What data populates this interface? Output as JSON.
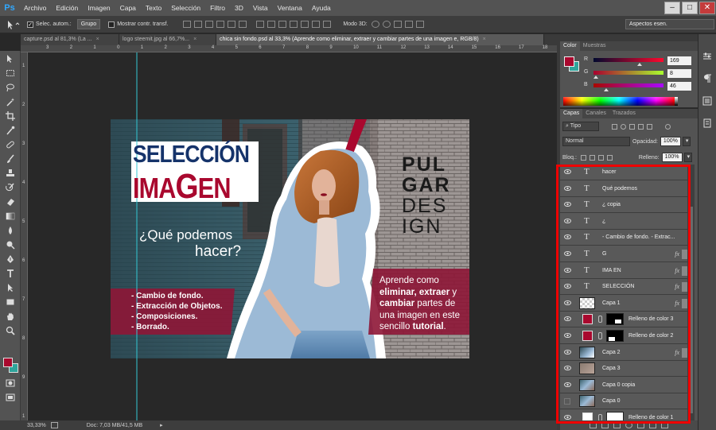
{
  "app": {
    "logo": "Ps"
  },
  "menu": [
    "Archivo",
    "Edición",
    "Imagen",
    "Capa",
    "Texto",
    "Selección",
    "Filtro",
    "3D",
    "Vista",
    "Ventana",
    "Ayuda"
  ],
  "window_controls": [
    "–",
    "□",
    "✕"
  ],
  "options": {
    "auto_select_label": "Selec. autom.:",
    "auto_select_value": "Grupo",
    "transform_label": "Mostrar contr. transf.",
    "mode3d_label": "Modo 3D:",
    "workspace": "Aspectos esen."
  },
  "tabs": [
    {
      "label": "capture.psd al 81,3% (La ...",
      "active": false
    },
    {
      "label": "logo steemit.jpg al 66,7%...",
      "active": false
    },
    {
      "label": "chica sin fondo.psd al 33,3% (Aprende como eliminar, extraer y cambiar partes de una imagen e, RGB/8)",
      "active": true
    }
  ],
  "tab_close": "×",
  "ruler_h": [
    "3",
    "2",
    "1",
    "0",
    "1",
    "2",
    "3",
    "4",
    "5",
    "6",
    "7",
    "8",
    "9",
    "10",
    "11",
    "12",
    "13",
    "14",
    "15",
    "16",
    "17",
    "18"
  ],
  "ruler_v": [
    "1",
    "2",
    "3",
    "4",
    "5",
    "6",
    "7",
    "8",
    "9",
    "1"
  ],
  "status": {
    "zoom": "33,33%",
    "doc": "Doc: 7,03 MB/41,5 MB"
  },
  "color_panel": {
    "tabs": [
      "Color",
      "Muestras"
    ],
    "r": 169,
    "g": 8,
    "b": 46,
    "labels": [
      "R",
      "G",
      "B"
    ],
    "foreground": "#a9082e",
    "background": "#ffffff"
  },
  "layers_panel": {
    "tabs": [
      "Capas",
      "Canales",
      "Trazados"
    ],
    "filter_label": "Tipo",
    "blend_mode": "Normal",
    "opacity_label": "Opacidad:",
    "opacity": "100%",
    "lock_label": "Bloq.:",
    "fill_label": "Relleno:",
    "fill": "100%",
    "fx": "fx",
    "layers": [
      {
        "name": "hacer",
        "kind": "text",
        "fx": false,
        "visible": true
      },
      {
        "name": "Qué podemos",
        "kind": "text",
        "fx": false,
        "visible": true
      },
      {
        "name": "¿ copia",
        "kind": "text",
        "fx": false,
        "visible": true
      },
      {
        "name": "¿",
        "kind": "text",
        "fx": false,
        "visible": true
      },
      {
        "name": "- Cambio de fondo. - Extrac...",
        "kind": "text",
        "fx": false,
        "visible": true
      },
      {
        "name": "G",
        "kind": "text",
        "fx": true,
        "visible": true
      },
      {
        "name": "IMA     EN",
        "kind": "text",
        "fx": true,
        "visible": true
      },
      {
        "name": "SELECCIÓN",
        "kind": "text",
        "fx": true,
        "visible": true
      },
      {
        "name": "Capa 1",
        "kind": "image-transparent",
        "fx": true,
        "visible": true
      },
      {
        "name": "Relleno de color 3",
        "kind": "fill",
        "fx": false,
        "visible": true
      },
      {
        "name": "Relleno de color 2",
        "kind": "fill",
        "fx": false,
        "visible": true
      },
      {
        "name": "Capa 2",
        "kind": "image-blue",
        "fx": true,
        "visible": true
      },
      {
        "name": "Capa 3",
        "kind": "image-tan",
        "fx": false,
        "visible": true
      },
      {
        "name": "Capa 0 copia",
        "kind": "image-blue2",
        "fx": false,
        "visible": true
      },
      {
        "name": "Capa 0",
        "kind": "image-blue2",
        "fx": false,
        "visible": false
      },
      {
        "name": "Relleno de color 1",
        "kind": "fill-white",
        "fx": false,
        "visible": true
      }
    ]
  },
  "canvas_image": {
    "title1": "SELECCIÓN",
    "title2a": "IMA",
    "title2b": "G",
    "title2c": "EN",
    "q1": "¿Qué podemos",
    "q2": "hacer?",
    "list": [
      "- Cambio de fondo.",
      "- Extracción de Objetos.",
      "- Composiciones.",
      "- Borrado."
    ],
    "brand": [
      "PUL",
      "GAR",
      "DES",
      "IGN"
    ],
    "desc_l1": "Aprende como",
    "desc_l2a": "eliminar, extraer",
    "desc_l2b": " y",
    "desc_l3a": "cambiar",
    "desc_l3b": " partes de",
    "desc_l4": "una imagen en este",
    "desc_l5a": "sencillo ",
    "desc_l5b": "tutorial",
    "desc_l5c": ".",
    "colors": {
      "navy": "#15336a",
      "crimson": "#a9082e",
      "banner": "#8e1636"
    }
  }
}
